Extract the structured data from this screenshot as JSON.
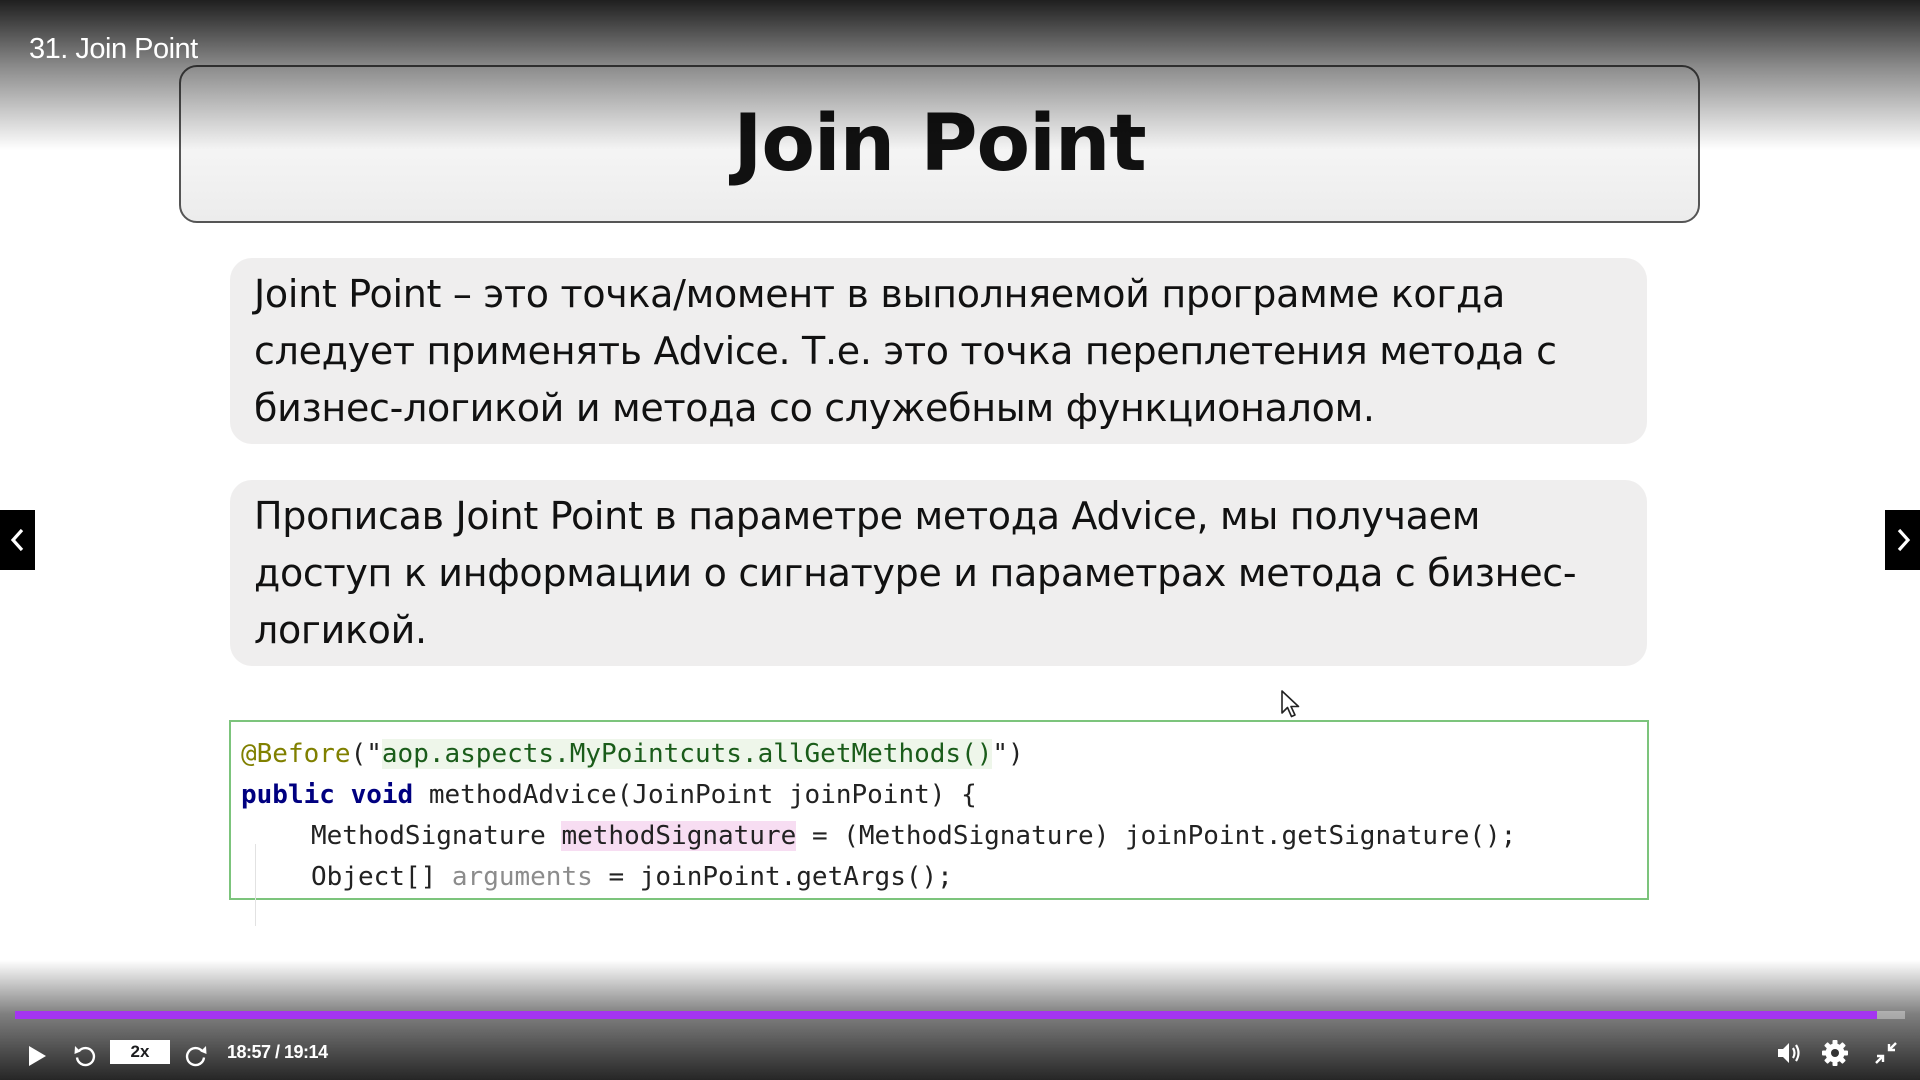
{
  "player": {
    "video_title": "31. Join Point",
    "speed_label": "2x",
    "time_display": "18:57 / 19:14",
    "progress": 0.985,
    "accent_color": "#a435f0"
  },
  "slide": {
    "title": "Join Point",
    "paragraphs": [
      [
        "Joint Point – это точка/момент в выполняемой программе когда",
        "следует применять Advice. Т.е. это точка переплетения метода с",
        "бизнес-логикой и метода со служебным функционалом."
      ],
      [
        "Прописав Joint Point в параметре метода Advice, мы получаем",
        "доступ к информации о сигнатуре и параметрах метода с бизнес-",
        "логикой."
      ]
    ],
    "code": {
      "annotation": "@Before",
      "annotation_open": "(\"",
      "annotation_value": "aop.aspects.MyPointcuts.allGetMethods()",
      "annotation_close": "\")",
      "kw_public": "public",
      "kw_void": "void",
      "method_decl": "methodAdvice(JoinPoint joinPoint) {",
      "sig_type": "MethodSignature",
      "sig_var": "methodSignature",
      "sig_rest": "= (MethodSignature) joinPoint.getSignature();",
      "args_type": "Object[]",
      "args_var": "arguments",
      "args_rest": "= joinPoint.getArgs();"
    }
  },
  "icons": {
    "play": "play-icon",
    "rewind": "rewind-icon",
    "forward": "forward-icon",
    "volume": "volume-icon",
    "settings": "gear-icon",
    "fullscreen": "exit-fullscreen-icon",
    "prev": "chevron-left-icon",
    "next": "chevron-right-icon",
    "cursor": "mouse-cursor-icon"
  }
}
